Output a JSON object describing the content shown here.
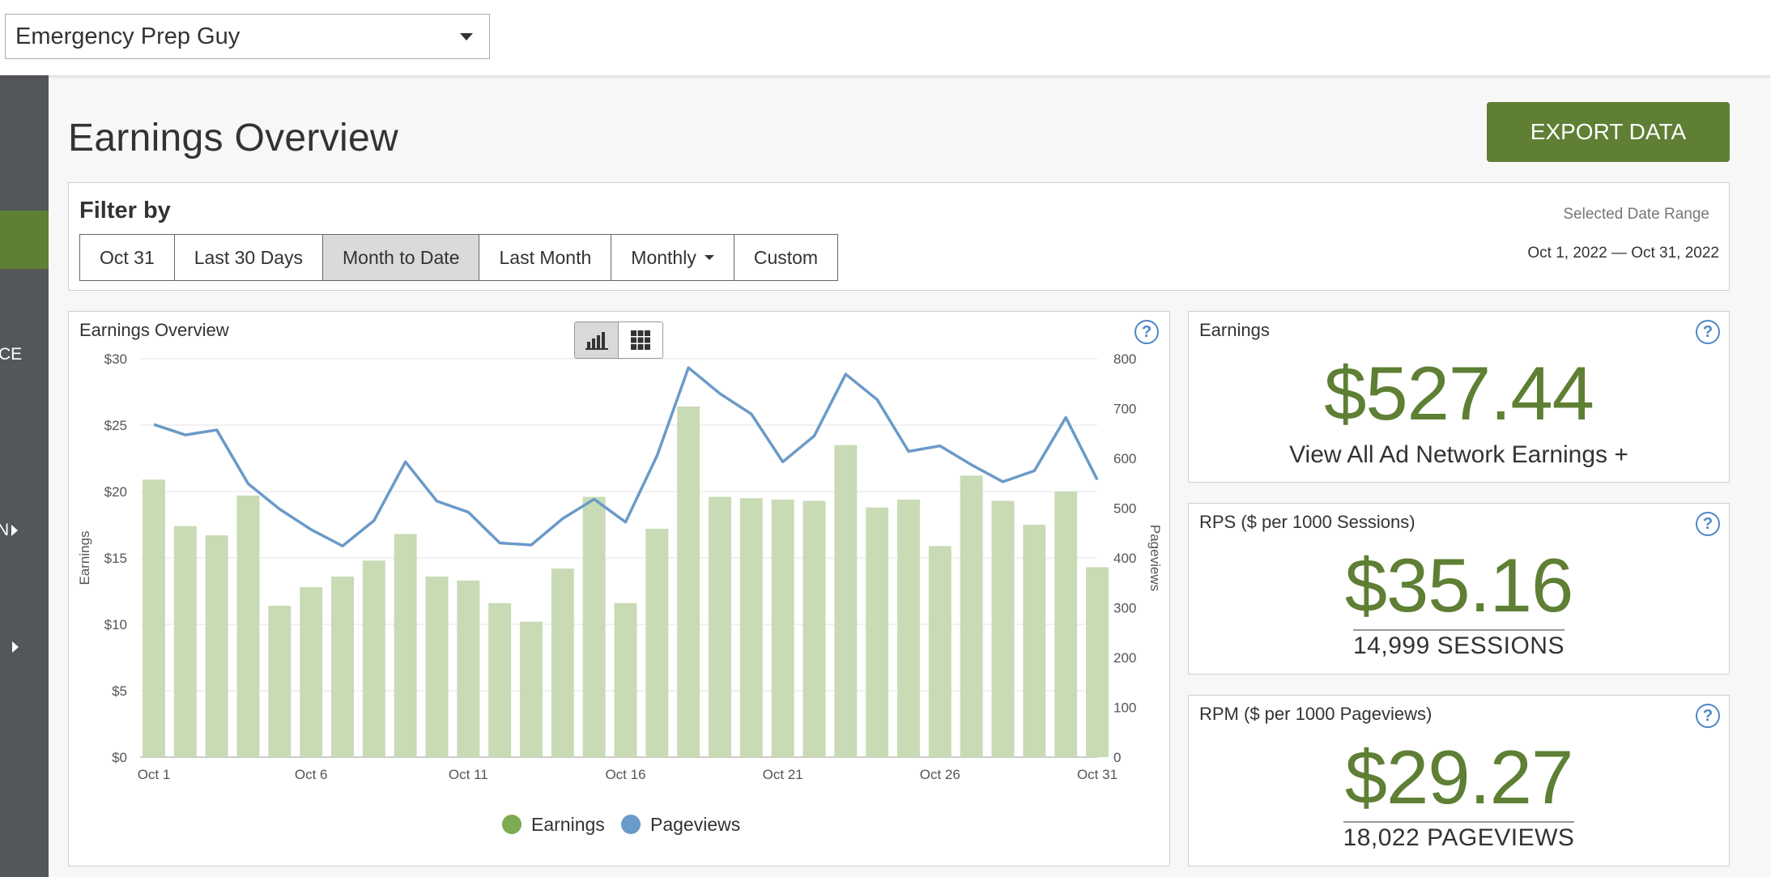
{
  "header": {
    "site_name": "Emergency Prep Guy"
  },
  "sidebar": {
    "items": [
      {
        "label": "CE"
      },
      {
        "label": "N"
      }
    ]
  },
  "page": {
    "title": "Earnings Overview",
    "export_label": "EXPORT DATA"
  },
  "filter": {
    "title": "Filter by",
    "buttons": [
      {
        "label": "Oct 31"
      },
      {
        "label": "Last 30 Days"
      },
      {
        "label": "Month to Date",
        "active": true
      },
      {
        "label": "Last Month"
      },
      {
        "label": "Monthly"
      },
      {
        "label": "Custom"
      }
    ],
    "date_range_label": "Selected Date Range",
    "date_range": "Oct 1, 2022 — Oct 31, 2022"
  },
  "chart_panel": {
    "title": "Earnings Overview",
    "help": "?"
  },
  "cards": {
    "earnings": {
      "title": "Earnings",
      "value": "$527.44",
      "link": "View All Ad Network Earnings +",
      "help": "?"
    },
    "rps": {
      "title": "RPS ($ per 1000 Sessions)",
      "value": "$35.16",
      "sub": "14,999 SESSIONS",
      "help": "?"
    },
    "rpm": {
      "title": "RPM ($ per 1000 Pageviews)",
      "value": "$29.27",
      "sub": "18,022 PAGEVIEWS",
      "help": "?"
    }
  },
  "colors": {
    "accent": "#5e7f34",
    "bar": "#c9dbb4",
    "line": "#6a9ac8",
    "legend_earnings": "#7dab4f",
    "legend_pageviews": "#6a9ac8"
  },
  "chart_data": {
    "type": "bar+line",
    "categories": [
      "Oct 1",
      "Oct 2",
      "Oct 3",
      "Oct 4",
      "Oct 5",
      "Oct 6",
      "Oct 7",
      "Oct 8",
      "Oct 9",
      "Oct 10",
      "Oct 11",
      "Oct 12",
      "Oct 13",
      "Oct 14",
      "Oct 15",
      "Oct 16",
      "Oct 17",
      "Oct 18",
      "Oct 19",
      "Oct 20",
      "Oct 21",
      "Oct 22",
      "Oct 23",
      "Oct 24",
      "Oct 25",
      "Oct 26",
      "Oct 27",
      "Oct 28",
      "Oct 29",
      "Oct 30",
      "Oct 31"
    ],
    "x_tick_labels": [
      "Oct 1",
      "Oct 6",
      "Oct 11",
      "Oct 16",
      "Oct 21",
      "Oct 26",
      "Oct 31"
    ],
    "series": [
      {
        "name": "Earnings",
        "axis": "left",
        "type": "bar",
        "values": [
          20.9,
          17.4,
          16.7,
          19.7,
          11.4,
          12.8,
          13.6,
          14.8,
          16.8,
          13.6,
          13.3,
          11.6,
          10.2,
          14.2,
          19.6,
          11.6,
          17.2,
          26.4,
          19.6,
          19.5,
          19.4,
          19.3,
          23.5,
          18.8,
          19.4,
          15.9,
          21.2,
          19.3,
          17.5,
          20.0,
          14.3
        ]
      },
      {
        "name": "Pageviews",
        "axis": "right",
        "type": "line",
        "values": [
          668,
          647,
          657,
          549,
          498,
          457,
          424,
          475,
          593,
          514,
          492,
          430,
          426,
          479,
          518,
          472,
          605,
          782,
          730,
          689,
          593,
          645,
          769,
          718,
          614,
          625,
          587,
          553,
          575,
          682,
          557
        ]
      }
    ],
    "y_left": {
      "label": "Earnings",
      "min": 0,
      "max": 30,
      "ticks": [
        "$0",
        "$5",
        "$10",
        "$15",
        "$20",
        "$25",
        "$30"
      ]
    },
    "y_right": {
      "label": "Pageviews",
      "min": 0,
      "max": 800,
      "ticks": [
        "0",
        "100",
        "200",
        "300",
        "400",
        "500",
        "600",
        "700",
        "800"
      ]
    },
    "legend": {
      "placement": "bottom",
      "items": [
        "Earnings",
        "Pageviews"
      ]
    },
    "grid": true
  }
}
